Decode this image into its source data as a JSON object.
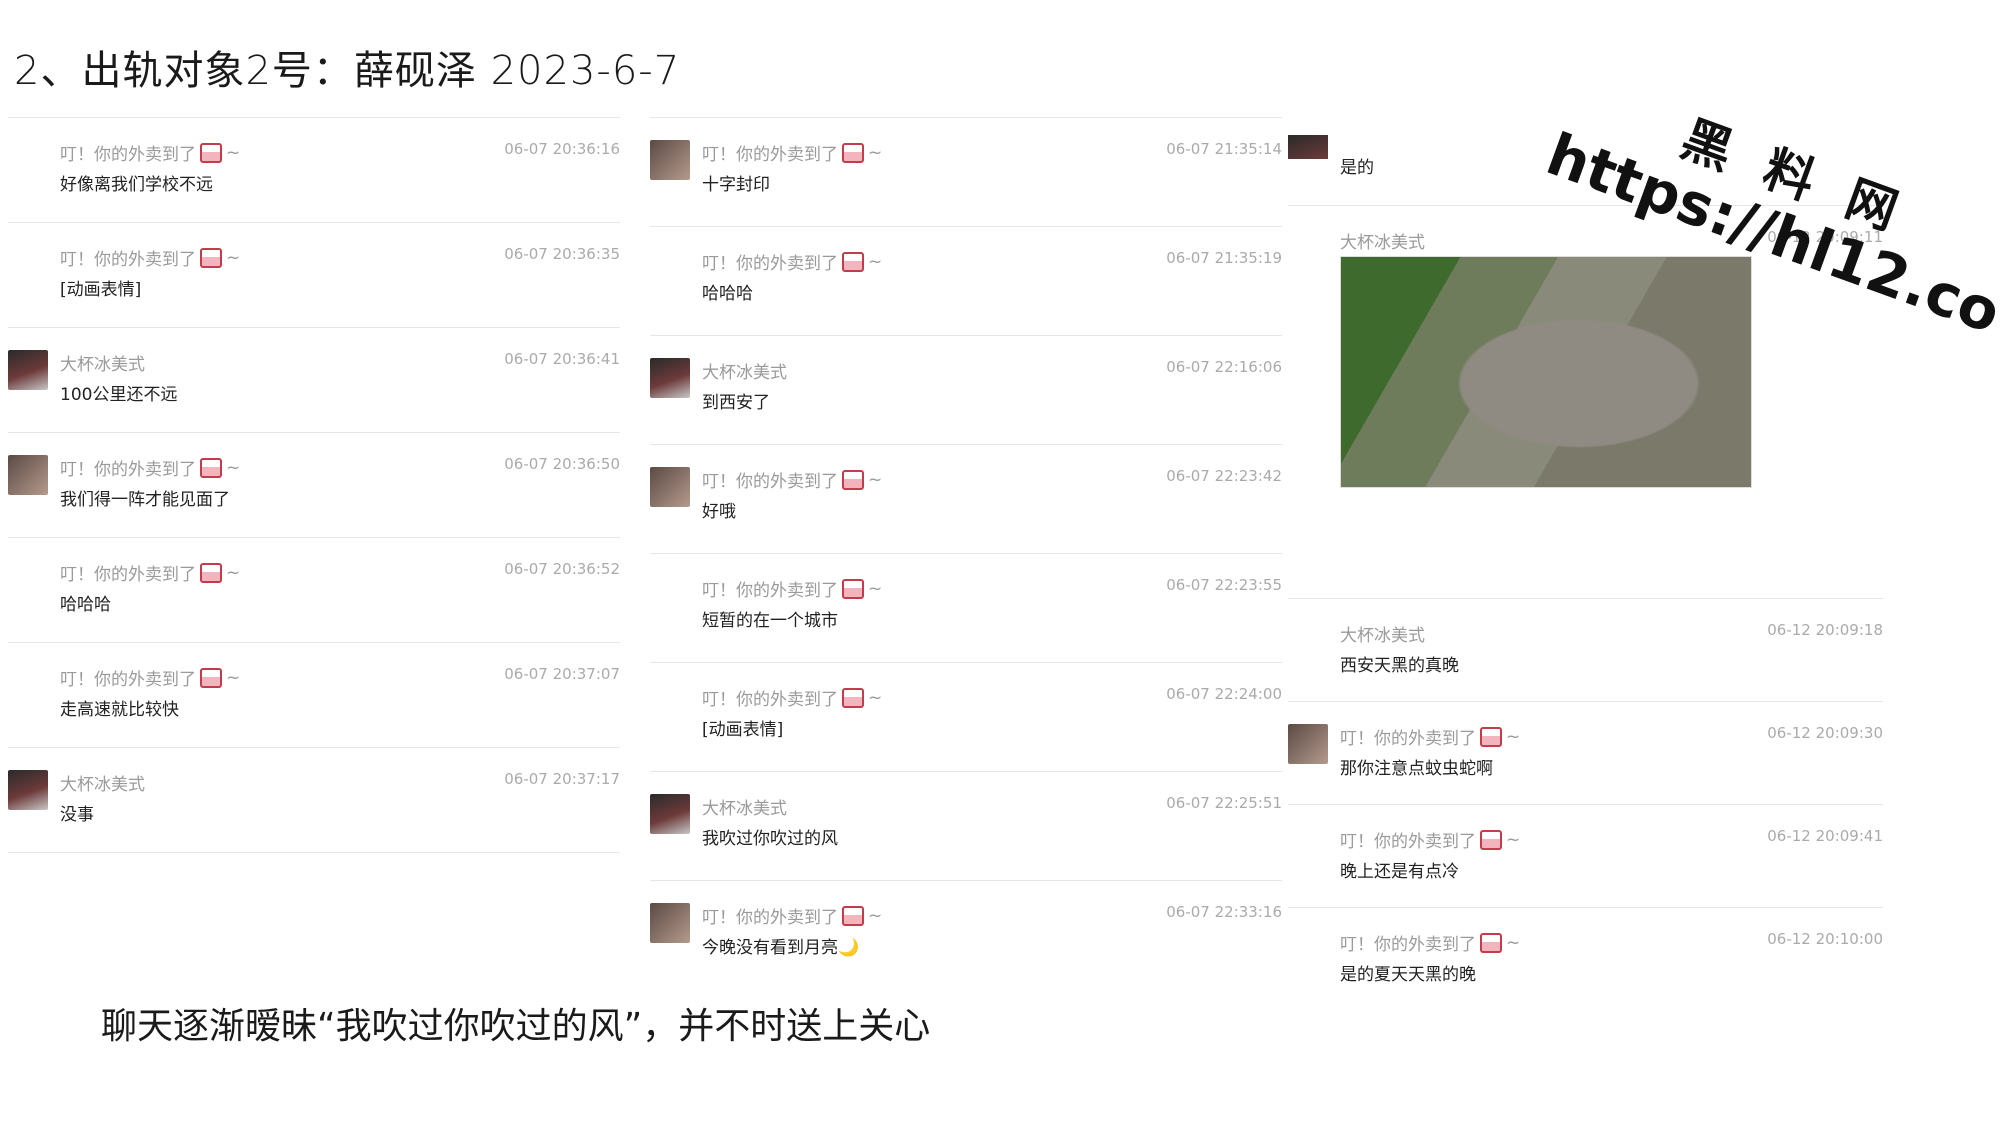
{
  "title": "2、出轨对象2号：薛砚泽  2023-6-7",
  "caption": "聊天逐渐暧昧“我吹过你吹过的风”，并不时送上关心",
  "watermark": {
    "cn": "黑 料 网",
    "url": "https://hl12.co"
  },
  "left_column": [
    {
      "sender": "叮！你的外卖到了",
      "time": "06-07 20:36:16",
      "text": "好像离我们学校不远",
      "avatar": false
    },
    {
      "sender": "叮！你的外卖到了",
      "time": "06-07 20:36:35",
      "text": "[动画表情]",
      "avatar": false
    },
    {
      "sender": "大杯冰美式",
      "time": "06-07 20:36:41",
      "text": "100公里还不远",
      "avatar": "dark"
    },
    {
      "sender": "叮！你的外卖到了",
      "time": "06-07 20:36:50",
      "text": "我们得一阵才能见面了",
      "avatar": "light"
    },
    {
      "sender": "叮！你的外卖到了",
      "time": "06-07 20:36:52",
      "text": "哈哈哈",
      "avatar": false
    },
    {
      "sender": "叮！你的外卖到了",
      "time": "06-07 20:37:07",
      "text": "走高速就比较快",
      "avatar": false
    },
    {
      "sender": "大杯冰美式",
      "time": "06-07 20:37:17",
      "text": "没事",
      "avatar": "dark"
    }
  ],
  "middle_column": [
    {
      "sender": "叮！你的外卖到了",
      "time": "06-07 21:35:14",
      "text": "十字封印",
      "avatar": "light"
    },
    {
      "sender": "叮！你的外卖到了",
      "time": "06-07 21:35:19",
      "text": "哈哈哈",
      "avatar": false
    },
    {
      "sender": "大杯冰美式",
      "time": "06-07 22:16:06",
      "text": "到西安了",
      "avatar": "dark"
    },
    {
      "sender": "叮！你的外卖到了",
      "time": "06-07 22:23:42",
      "text": "好哦",
      "avatar": "light"
    },
    {
      "sender": "叮！你的外卖到了",
      "time": "06-07 22:23:55",
      "text": "短暂的在一个城市",
      "avatar": false
    },
    {
      "sender": "叮！你的外卖到了",
      "time": "06-07 22:24:00",
      "text": "[动画表情]",
      "avatar": false
    },
    {
      "sender": "大杯冰美式",
      "time": "06-07 22:25:51",
      "text": "我吹过你吹过的风",
      "avatar": "dark"
    },
    {
      "sender": "叮！你的外卖到了",
      "time": "06-07 22:33:16",
      "text": "今晚没有看到月亮🌙",
      "avatar": "light"
    }
  ],
  "right_column": {
    "top_text": "是的",
    "photo_sender": "大杯冰美式",
    "photo_time": "06-12 20:09:11",
    "messages": [
      {
        "sender": "大杯冰美式",
        "time": "06-12 20:09:18",
        "text": "西安天黑的真晚",
        "avatar": false
      },
      {
        "sender": "叮！你的外卖到了",
        "time": "06-12 20:09:30",
        "text": "那你注意点蚊虫蛇啊",
        "avatar": "light"
      },
      {
        "sender": "叮！你的外卖到了",
        "time": "06-12 20:09:41",
        "text": "晚上还是有点冷",
        "avatar": false
      },
      {
        "sender": "叮！你的外卖到了",
        "time": "06-12 20:10:00",
        "text": "是的夏天天黑的晚",
        "avatar": false
      }
    ]
  }
}
